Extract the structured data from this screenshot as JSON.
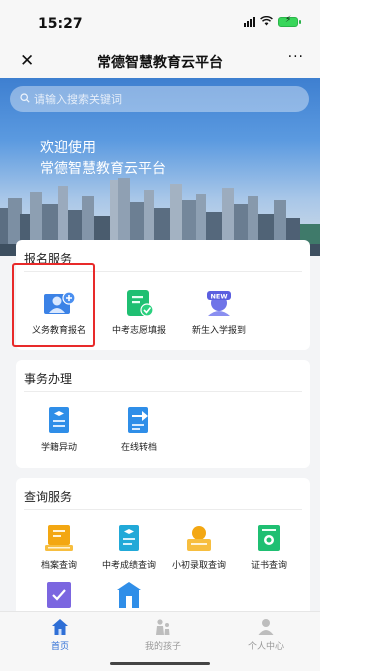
{
  "status_bar": {
    "time": "15:27"
  },
  "nav": {
    "title": "常德智慧教育云平台",
    "close_glyph": "✕",
    "more_glyph": "···"
  },
  "banner": {
    "search_placeholder": "请输入搜索关键词",
    "welcome_line1": "欢迎使用",
    "welcome_line2": "常德智慧教育云平台"
  },
  "sections": {
    "registration": {
      "title": "报名服务",
      "items": [
        {
          "label": "义务教育报名",
          "icon": "user-add-icon"
        },
        {
          "label": "中考志愿填报",
          "icon": "list-check-icon"
        },
        {
          "label": "新生入学报到",
          "icon": "new-student-icon"
        }
      ]
    },
    "affairs": {
      "title": "事务办理",
      "items": [
        {
          "label": "学籍异动",
          "icon": "student-record-icon"
        },
        {
          "label": "在线转档",
          "icon": "transfer-file-icon"
        }
      ]
    },
    "query": {
      "title": "查询服务",
      "items": [
        {
          "label": "档案查询",
          "icon": "archive-icon"
        },
        {
          "label": "中考成绩查询",
          "icon": "exam-score-icon"
        },
        {
          "label": "小初录取查询",
          "icon": "admission-icon"
        },
        {
          "label": "证书查询",
          "icon": "certificate-icon"
        },
        {
          "label": "",
          "icon": "checklist-icon"
        },
        {
          "label": "",
          "icon": "school-icon"
        }
      ]
    }
  },
  "tabbar": {
    "items": [
      {
        "label": "首页",
        "icon": "home-icon",
        "active": true
      },
      {
        "label": "我的孩子",
        "icon": "children-icon",
        "active": false
      },
      {
        "label": "个人中心",
        "icon": "person-icon",
        "active": false
      }
    ]
  },
  "colors": {
    "accent": "#2f6fd6",
    "highlight": "#e82a2a",
    "green": "#1fbf72"
  }
}
